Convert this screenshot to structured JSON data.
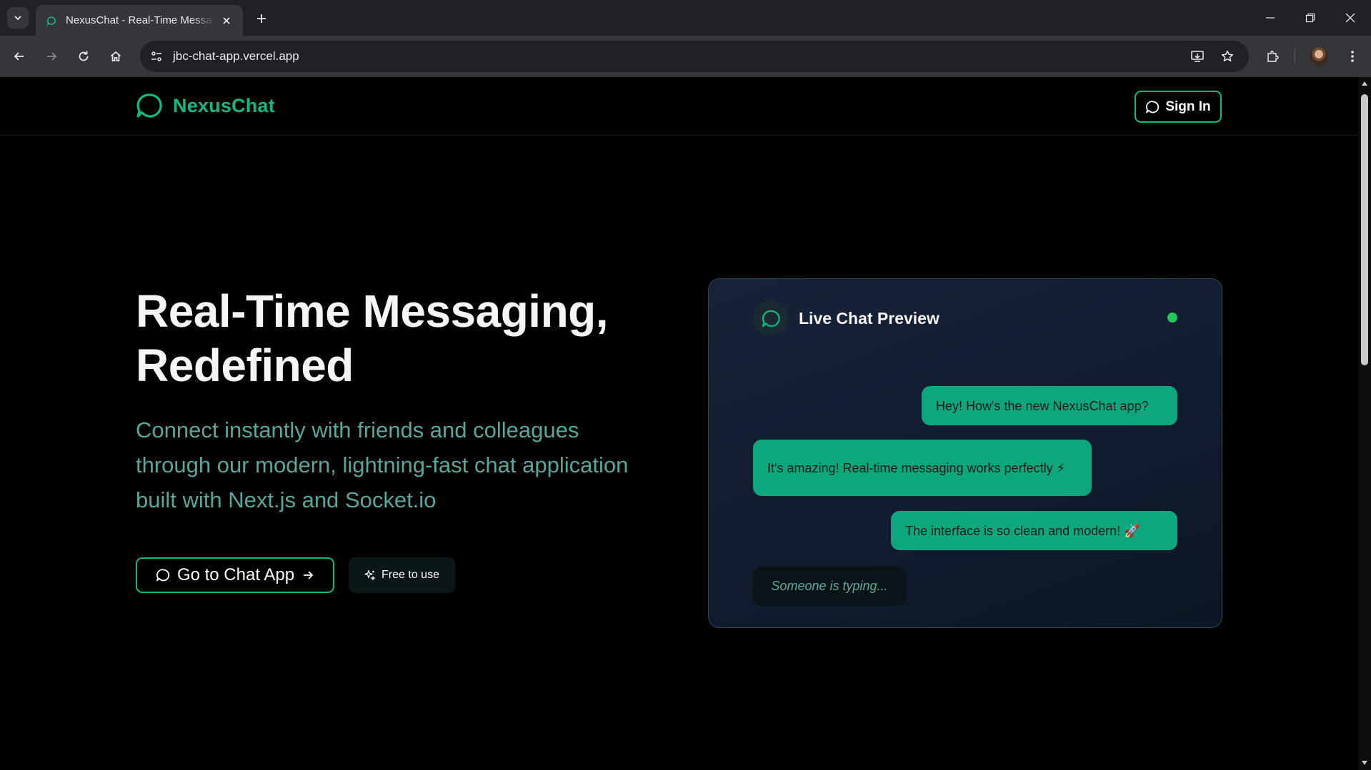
{
  "browser": {
    "tab_title": "NexusChat - Real-Time Messaging",
    "url": "jbc-chat-app.vercel.app"
  },
  "header": {
    "brand": "NexusChat",
    "signin_label": "Sign In"
  },
  "hero": {
    "title_line1": "Real-Time Messaging,",
    "title_line2": "Redefined",
    "subtitle": "Connect instantly with friends and colleagues through our modern, lightning-fast chat application built with Next.js and Socket.io",
    "cta_label": "Go to Chat App",
    "badge_label": "Free to use"
  },
  "preview": {
    "title": "Live Chat Preview",
    "messages": [
      "Hey! How's the new NexusChat app?",
      "It's amazing! Real-time messaging works perfectly ⚡",
      "The interface is so clean and modern! 🚀"
    ],
    "typing": "Someone is typing..."
  },
  "colors": {
    "accent": "#10b981",
    "bubble": "#0ea67d",
    "online": "#22c55e",
    "subtitle": "#58a79a"
  }
}
